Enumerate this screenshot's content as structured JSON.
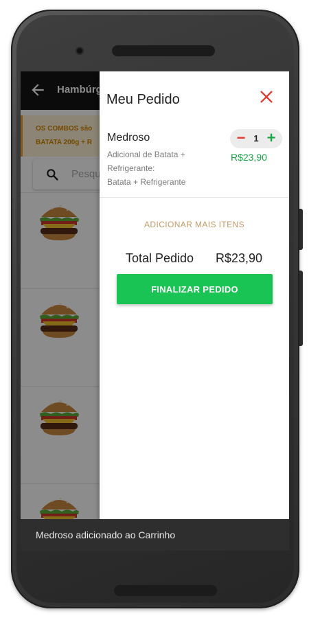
{
  "app_bar": {
    "title": "Hambúrg"
  },
  "promo": {
    "text": "OS COMBOS são\nBATATA 200g + R"
  },
  "search": {
    "placeholder": "Pesqu"
  },
  "cart": {
    "title": "Meu Pedido",
    "item": {
      "name": "Medroso",
      "description": "Adicional de Batata +\nRefrigerante:\nBatata + Refrigerante",
      "quantity": "1",
      "price": "R$23,90"
    },
    "add_more_label": "ADICIONAR MAIS ITENS",
    "total_label": "Total Pedido",
    "total_value": "R$23,90",
    "finalize_label": "FINALIZAR PEDIDO"
  },
  "snackbar": {
    "message": "Medroso adicionado ao Carrinho"
  },
  "icons": {
    "back": "arrow-left-icon",
    "close": "close-icon",
    "search": "search-icon",
    "product": "burger-icon"
  },
  "colors": {
    "accent_green": "#19c454",
    "price_green": "#19a845",
    "close_red": "#e23b2f",
    "secondary_gold": "#c49a66"
  }
}
